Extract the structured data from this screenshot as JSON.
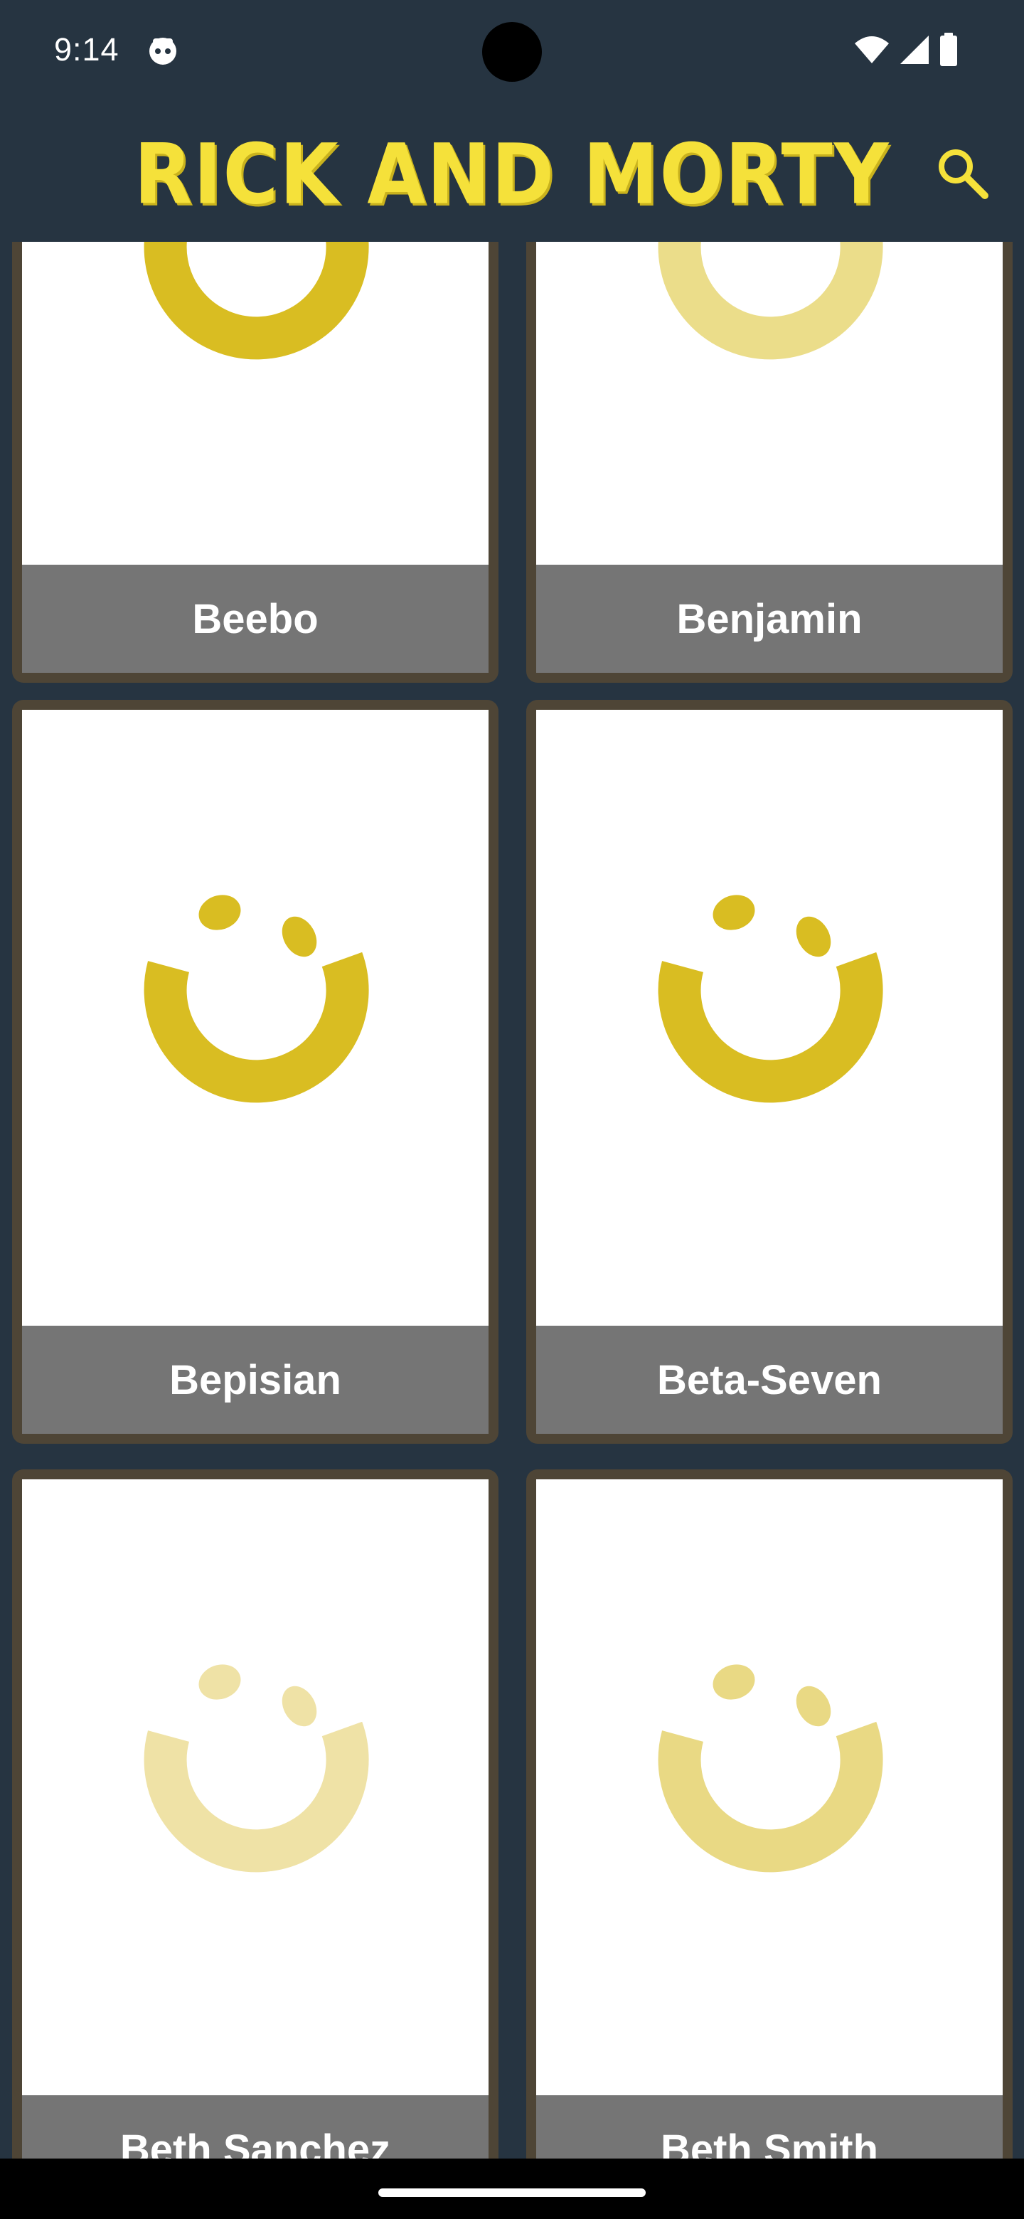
{
  "status_bar": {
    "time": "9:14",
    "app_icon": "face-icon",
    "icons": [
      "wifi-icon",
      "cellular-signal-icon",
      "battery-icon"
    ]
  },
  "app_bar": {
    "title": "RICK AND MORTY",
    "title_color": "#f5e13a",
    "search_icon": "search-icon"
  },
  "characters": [
    {
      "name": "Beebo",
      "image": "loading-spinner-icon",
      "spinner_color": "#d9bd22"
    },
    {
      "name": "Benjamin",
      "image": "loading-spinner-icon",
      "spinner_color": "#ebdd8a"
    },
    {
      "name": "Bepisian",
      "image": "loading-spinner-icon",
      "spinner_color": "#d9bd22"
    },
    {
      "name": "Beta-Seven",
      "image": "loading-spinner-icon",
      "spinner_color": "#d9bd22"
    },
    {
      "name": "Beth Sanchez",
      "image": "loading-spinner-icon",
      "spinner_color": "#efe2a6"
    },
    {
      "name": "Beth Smith",
      "image": "loading-spinner-icon",
      "spinner_color": "#e9d984"
    }
  ],
  "colors": {
    "background": "#263441",
    "card_border": "#4e4536",
    "label_background": "#757575",
    "label_text": "#ffffff"
  }
}
